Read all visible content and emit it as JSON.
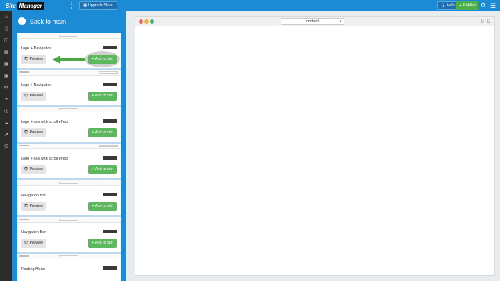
{
  "topbar": {
    "logo_word1": "Site",
    "logo_word2": "Manager",
    "upgrade_label": "Upgrade Store",
    "help_label": "Help",
    "publish_label": "Publish"
  },
  "panel": {
    "back_label": "Back to main",
    "preview_label": "Preview",
    "add_label": "Add to site",
    "cards": [
      {
        "title": "Logo + Navigation",
        "thumb": "Your Logo Here"
      },
      {
        "title": "Logo + Navigation",
        "thumb": "Your Logo Here"
      },
      {
        "title": "Logo + nav with scroll effect",
        "thumb": "Your Logo Here"
      },
      {
        "title": "Logo + nav with scroll effect",
        "thumb": "Your Logo Here"
      },
      {
        "title": "Navigation Bar",
        "thumb": ""
      },
      {
        "title": "Navigation Bar",
        "thumb": ""
      },
      {
        "title": "Floating Menu",
        "thumb": "Your Logo Here"
      }
    ]
  },
  "content": {
    "page_select_value": "content",
    "dot_colors": [
      "#e96b5b",
      "#f0b441",
      "#3fb27f"
    ]
  },
  "colors": {
    "brand_blue": "#1a8bd4",
    "add_green": "#5cb85c",
    "rail_dark": "#2b2b2b"
  }
}
